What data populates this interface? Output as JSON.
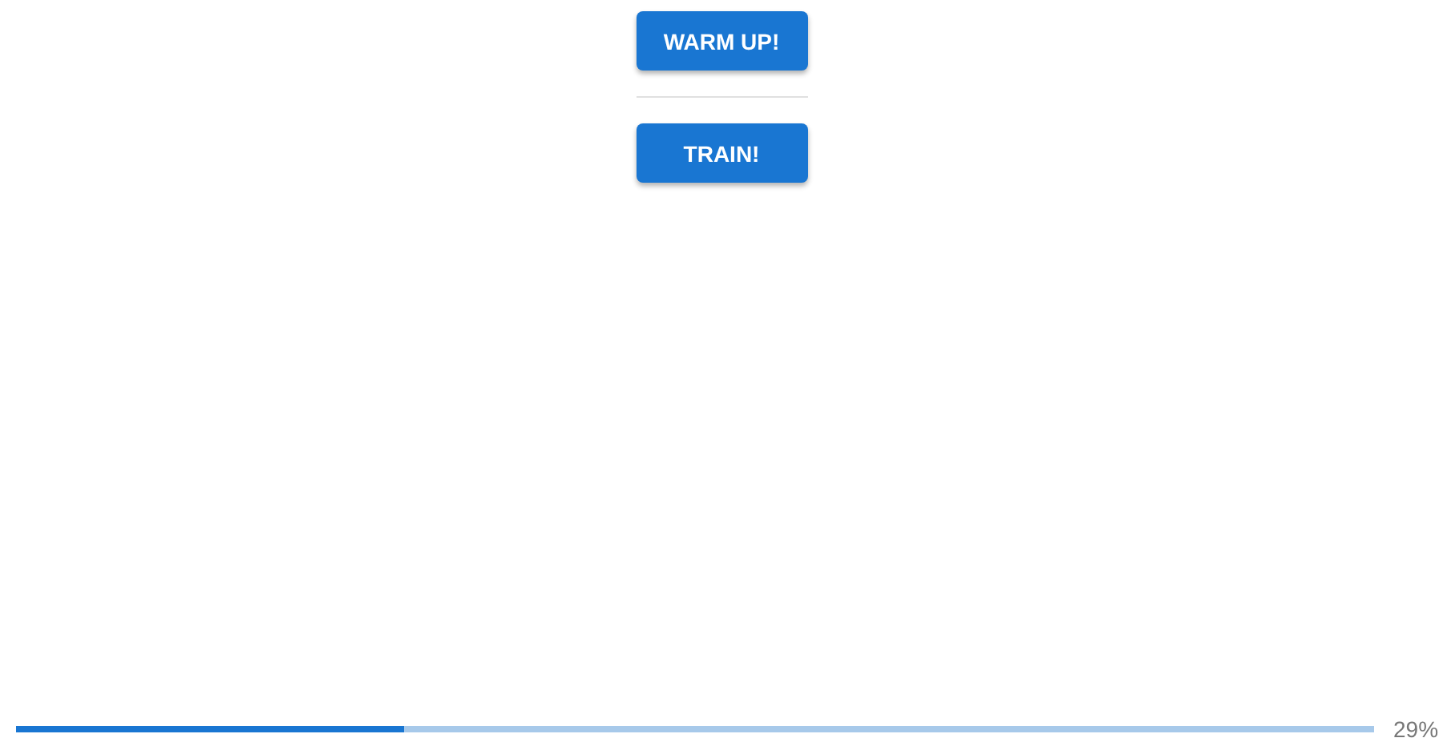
{
  "buttons": [
    {
      "label": "WARM UP!"
    },
    {
      "label": "TRAIN!"
    }
  ],
  "progress": {
    "level": 0.286,
    "reading": "29%"
  }
}
